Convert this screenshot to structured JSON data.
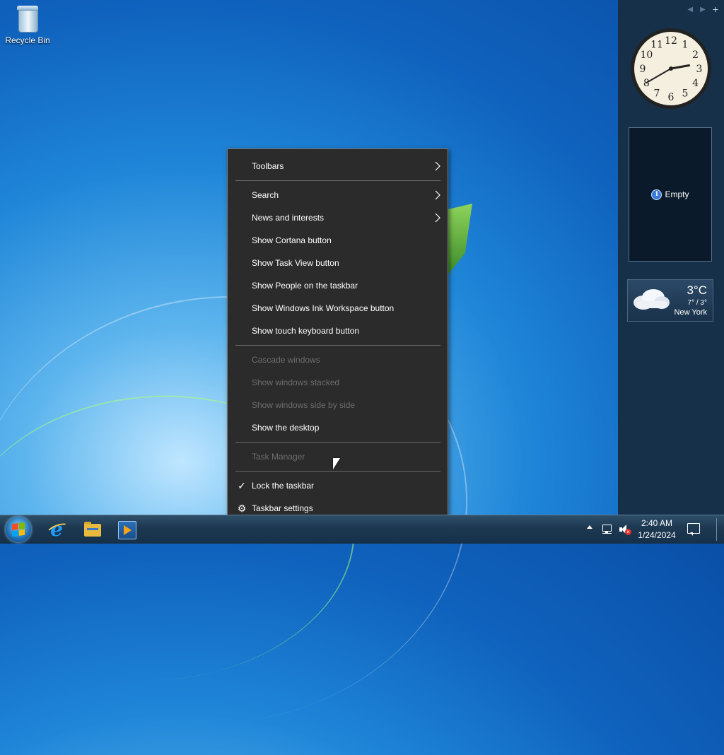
{
  "desktop": {
    "icons": [
      {
        "label": "Recycle Bin",
        "icon": "recycle-bin-icon"
      }
    ]
  },
  "gadgets": {
    "clock": {
      "hour": 2,
      "minute": 40,
      "numerals": [
        "12",
        "1",
        "2",
        "3",
        "4",
        "5",
        "6",
        "7",
        "8",
        "9",
        "10",
        "11"
      ]
    },
    "slideshow": {
      "text": "Empty",
      "icon": "info-icon"
    },
    "weather": {
      "temp": "3°C",
      "range": "7° / 3°",
      "city": "New York",
      "icon": "cloud-icon"
    }
  },
  "context_menu": {
    "items": [
      {
        "label": "Toolbars",
        "submenu": true,
        "enabled": true
      },
      {
        "label": "Search",
        "submenu": true,
        "enabled": true
      },
      {
        "label": "News and interests",
        "submenu": true,
        "enabled": true
      },
      {
        "label": "Show Cortana button",
        "enabled": true
      },
      {
        "label": "Show Task View button",
        "enabled": true
      },
      {
        "label": "Show People on the taskbar",
        "enabled": true
      },
      {
        "label": "Show Windows Ink Workspace button",
        "enabled": true
      },
      {
        "label": "Show touch keyboard button",
        "enabled": true
      },
      {
        "label": "Cascade windows",
        "enabled": false
      },
      {
        "label": "Show windows stacked",
        "enabled": false
      },
      {
        "label": "Show windows side by side",
        "enabled": false
      },
      {
        "label": "Show the desktop",
        "enabled": true
      },
      {
        "label": "Task Manager",
        "enabled": false
      },
      {
        "label": "Lock the taskbar",
        "enabled": true,
        "checked": true
      },
      {
        "label": "Taskbar settings",
        "enabled": true,
        "icon": "gear-icon"
      }
    ]
  },
  "taskbar": {
    "apps": [
      {
        "name": "Internet Explorer",
        "icon": "internet-explorer-icon"
      },
      {
        "name": "File Explorer",
        "icon": "file-explorer-icon"
      },
      {
        "name": "Media Player",
        "icon": "media-player-icon"
      }
    ],
    "tray": {
      "time": "2:40 AM",
      "date": "1/24/2024",
      "icons": [
        "show-hidden-icons-arrow",
        "network-icon",
        "volume-muted-icon",
        "action-center-icon"
      ]
    }
  },
  "colors": {
    "menu_bg": "#2b2b2b",
    "menu_disabled": "#6d6d6d",
    "sidebar_bg": "#163049"
  }
}
